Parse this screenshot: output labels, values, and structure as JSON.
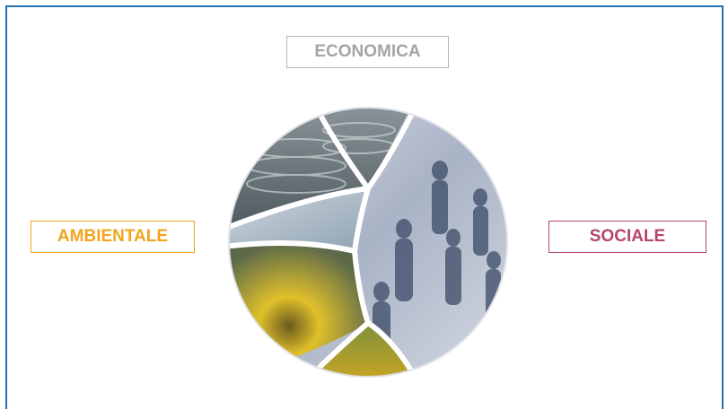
{
  "labels": {
    "economica": "ECONOMICA",
    "ambientale": "AMBIENTALE",
    "sociale": "SOCIALE"
  },
  "colors": {
    "frame_border": "#1f6fb2",
    "economica": "#a5a5a5",
    "ambientale": "#f2a41c",
    "sociale": "#b4456f"
  },
  "segments": [
    {
      "name": "coins-photo",
      "depicts": "coins"
    },
    {
      "name": "sky-photo",
      "depicts": "clouds"
    },
    {
      "name": "sunflower-photo",
      "depicts": "sunflower"
    },
    {
      "name": "sunflowers-field-photo",
      "depicts": "sunflowers"
    },
    {
      "name": "people-photo",
      "depicts": "people walking"
    }
  ]
}
